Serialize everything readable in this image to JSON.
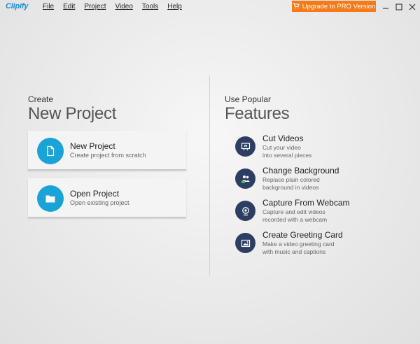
{
  "app": {
    "logo": "Clipify",
    "menu": [
      "File",
      "Edit",
      "Project",
      "Video",
      "Tools",
      "Help"
    ],
    "upgrade_label": "Upgrade to PRO Version",
    "accent": "#f47a1a"
  },
  "left": {
    "small_heading": "Create",
    "large_heading": "New Project",
    "cards": [
      {
        "title": "New Project",
        "subtitle": "Create project from scratch",
        "icon": "document-icon"
      },
      {
        "title": "Open Project",
        "subtitle": "Open existing project",
        "icon": "folder-icon"
      }
    ]
  },
  "right": {
    "small_heading": "Use Popular",
    "large_heading": "Features",
    "features": [
      {
        "title": "Cut Videos",
        "line1": "Cut your video",
        "line2": "into several pieces",
        "icon": "video-cut-icon"
      },
      {
        "title": "Change Background",
        "line1": "Replace plain colored",
        "line2": "background in videos",
        "icon": "change-background-icon"
      },
      {
        "title": "Capture From Webcam",
        "line1": "Capture and edit videos",
        "line2": "recorded with a webcam",
        "icon": "webcam-icon"
      },
      {
        "title": "Create Greeting Card",
        "line1": "Make a video greeting card",
        "line2": "with music and captions",
        "icon": "greeting-card-icon"
      }
    ]
  }
}
